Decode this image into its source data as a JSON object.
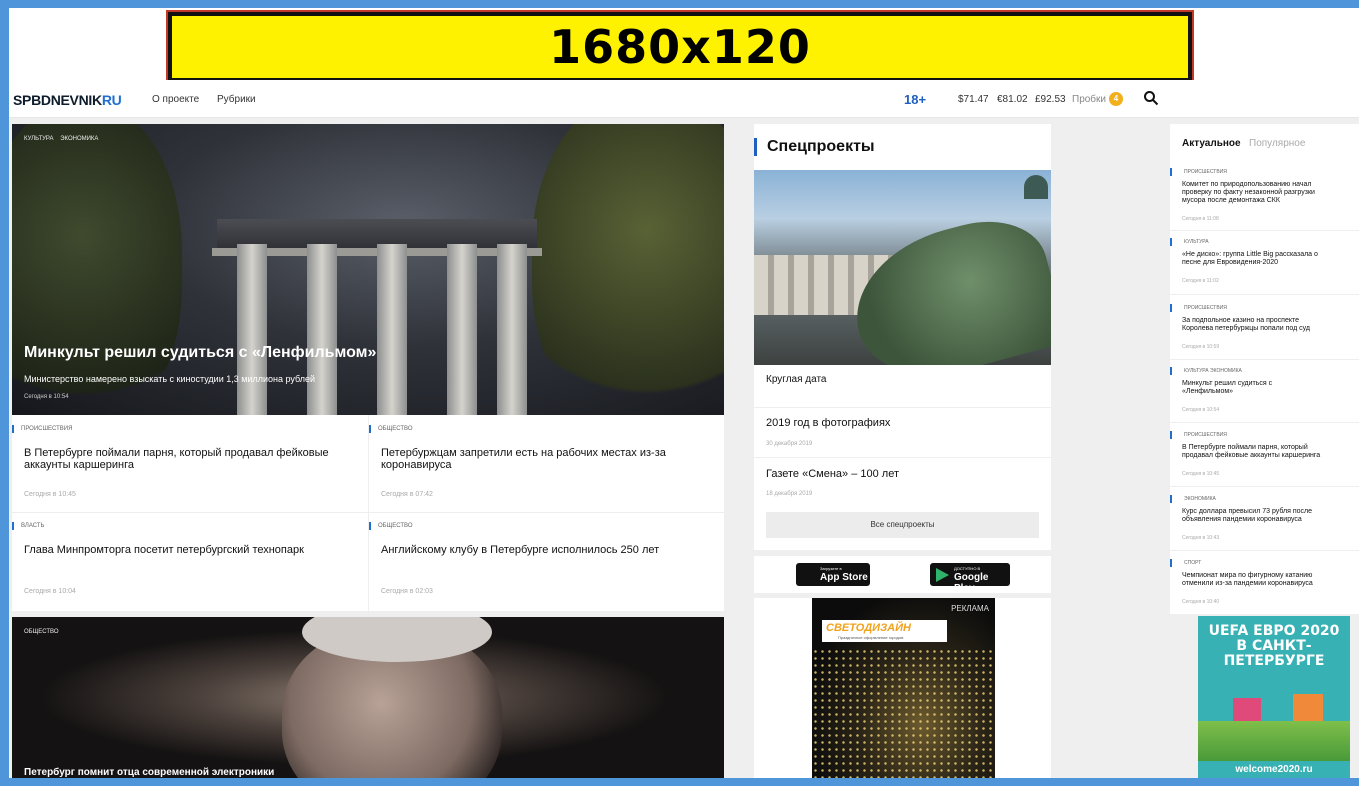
{
  "banner": {
    "text": "1680x120"
  },
  "header": {
    "logo_a": "SPB",
    "logo_b": "DNEVNIK",
    "logo_c": "RU",
    "nav": [
      "О проекте",
      "Рубрики"
    ],
    "age": "18+",
    "rates": [
      "$71.47",
      "€81.02",
      "£92.53"
    ],
    "jams_label": "Пробки",
    "jams_value": "4",
    "search_icon": "search-icon"
  },
  "hero": {
    "tags": [
      "КУЛЬТУРА",
      "ЭКОНОМИКА"
    ],
    "title": "Минкульт решил судиться с «Ленфильмом»",
    "lead": "Министерство намерено взыскать с киностудии 1,3 миллиона рублей",
    "time": "Сегодня в 10:54"
  },
  "cards": [
    {
      "rubric": "ПРОИСШЕСТВИЯ",
      "title": "В Петербурге поймали парня, который продавал фейковые аккаунты каршеринга",
      "time": "Сегодня в 10:45"
    },
    {
      "rubric": "ОБЩЕСТВО",
      "title": "Петербуржцам запретили есть на рабочих местах из-за коронавируса",
      "time": "Сегодня в 07:42"
    },
    {
      "rubric": "ВЛАСТЬ",
      "title": "Глава Минпромторга посетит петербургский технопарк",
      "time": "Сегодня в 10:04"
    },
    {
      "rubric": "ОБЩЕСТВО",
      "title": "Английскому клубу в Петербурге исполнилось 250 лет",
      "time": "Сегодня в 02:03"
    }
  ],
  "hero2": {
    "tag": "ОБЩЕСТВО",
    "title": "Петербург помнит отца современной электроники"
  },
  "spec": {
    "title": "Спецпроекты",
    "items": [
      {
        "title": "Круглая дата",
        "date": ""
      },
      {
        "title": "2019 год в фотографиях",
        "date": "30 декабря 2019"
      },
      {
        "title": "Газете «Смена» – 100 лет",
        "date": "18 декабря 2019"
      }
    ],
    "all_button": "Все спецпроекты"
  },
  "apps": {
    "appstore_small": "Загрузите в",
    "appstore": "App Store",
    "gplay_small": "ДОСТУПНО В",
    "gplay": "Google Play"
  },
  "ad": {
    "mark": "РЕКЛАМА",
    "brand": "СВЕТОДИЗАЙН",
    "sub": "Праздничное оформление городов"
  },
  "feed": {
    "tabs": [
      "Актуальное",
      "Популярное"
    ],
    "items": [
      {
        "rubric": "ПРОИСШЕСТВИЯ",
        "title": "Комитет по природопользованию начал\nпроверку по факту незаконной разгрузки\nмусора после демонтажа СКК",
        "time": "Сегодня в 11:08"
      },
      {
        "rubric": "КУЛЬТУРА",
        "title": "«Не диско»: группа Little Big рассказала о\nпесне для Евровидения-2020",
        "time": "Сегодня в 11:02"
      },
      {
        "rubric": "ПРОИСШЕСТВИЯ",
        "title": "За подпольное казино на проспекте\nКоролева петербуржцы попали под суд",
        "time": "Сегодня в 10:59"
      },
      {
        "rubric": "КУЛЬТУРА  ЭКОНОМИКА",
        "title": "Минкульт решил судиться с\n«Ленфильмом»",
        "time": "Сегодня в 10:54"
      },
      {
        "rubric": "ПРОИСШЕСТВИЯ",
        "title": "В Петербурге поймали парня, который\nпродавал фейковые аккаунты каршеринга",
        "time": "Сегодня в 10:45"
      },
      {
        "rubric": "ЭКОНОМИКА",
        "title": "Курс доллара превысил 73 рубля после\nобъявления пандемии коронавируса",
        "time": "Сегодня в 10:43"
      },
      {
        "rubric": "СПОРТ",
        "title": "Чемпионат мира по фигурному катанию\nотменили из-за пандемии коронавируса",
        "time": "Сегодня в 10:40"
      }
    ]
  },
  "euro": {
    "title": "UEFA ЕВРО 2020\nВ САНКТ-\nПЕТЕРБУРГЕ",
    "url": "welcome2020.ru"
  },
  "colors": {
    "accent": "#1f5fbf",
    "frame": "#4f95d9",
    "banner": "#fff200",
    "jams": "#f2b01e"
  }
}
